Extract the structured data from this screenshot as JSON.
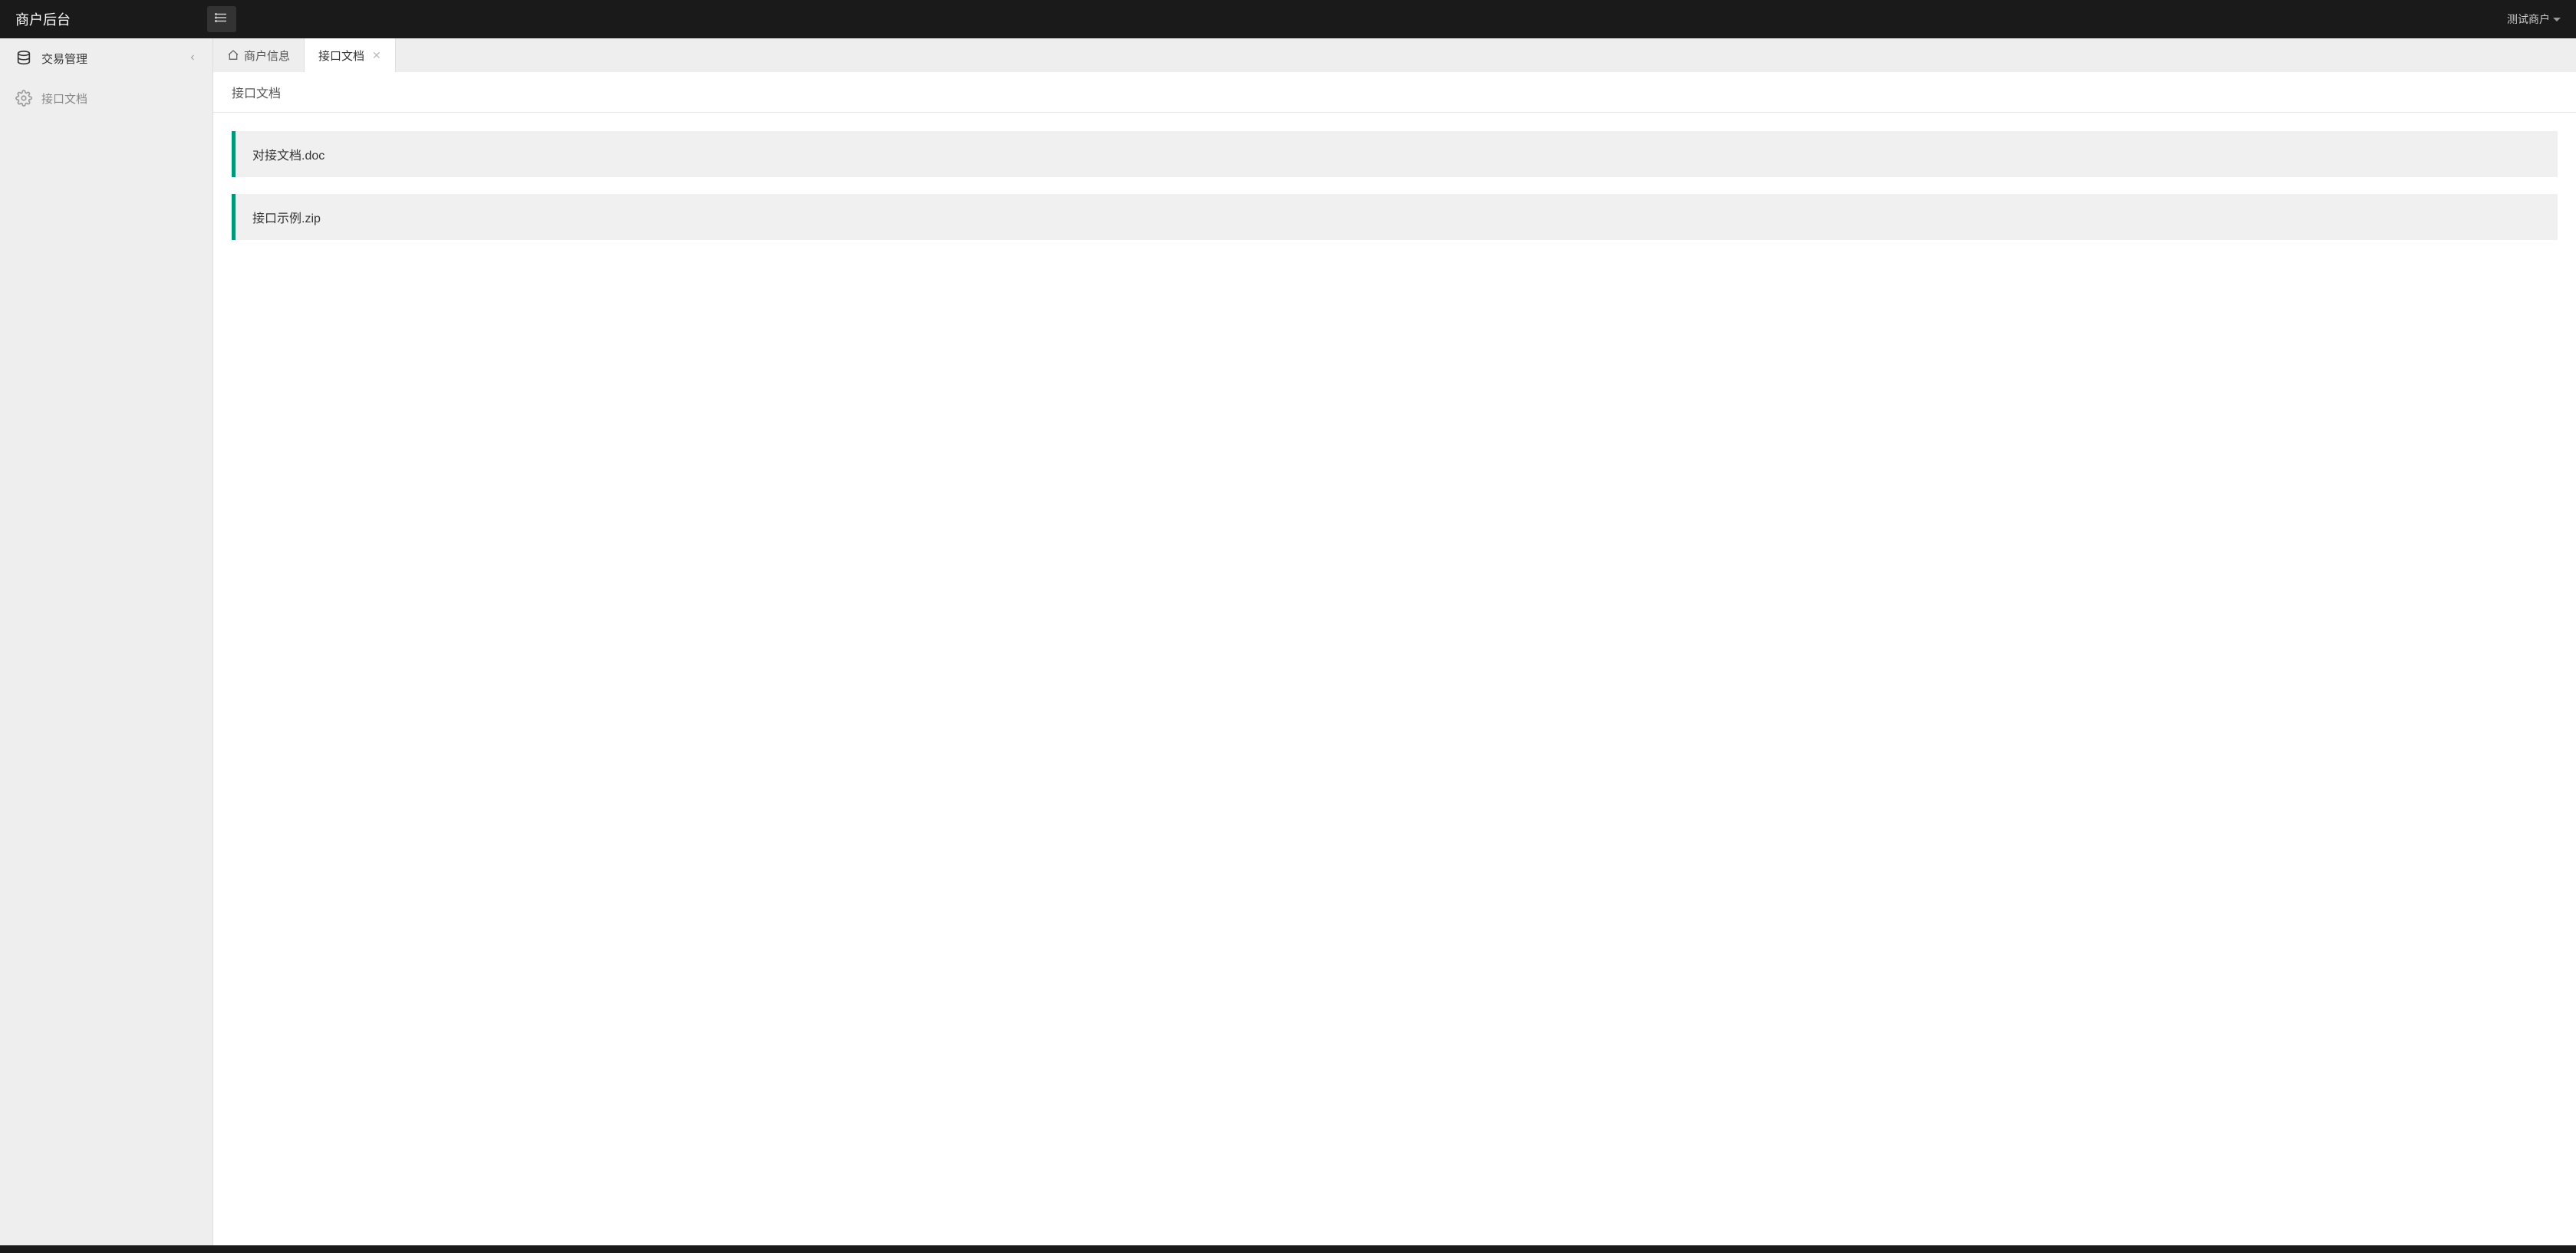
{
  "header": {
    "app_title": "商户后台",
    "user_label": "测试商户"
  },
  "sidebar": {
    "items": [
      {
        "label": "交易管理",
        "icon": "database",
        "has_children": true
      },
      {
        "label": "接口文档",
        "icon": "gear",
        "has_children": false
      }
    ]
  },
  "tabs": [
    {
      "label": "商户信息",
      "icon": "home",
      "active": false,
      "closable": false
    },
    {
      "label": "接口文档",
      "icon": null,
      "active": true,
      "closable": true
    }
  ],
  "page": {
    "title": "接口文档",
    "files": [
      {
        "name": "对接文档.doc"
      },
      {
        "name": "接口示例.zip"
      }
    ]
  },
  "colors": {
    "accent": "#009879",
    "header_bg": "#1a1a1a",
    "sidebar_bg": "#eeeeee"
  }
}
